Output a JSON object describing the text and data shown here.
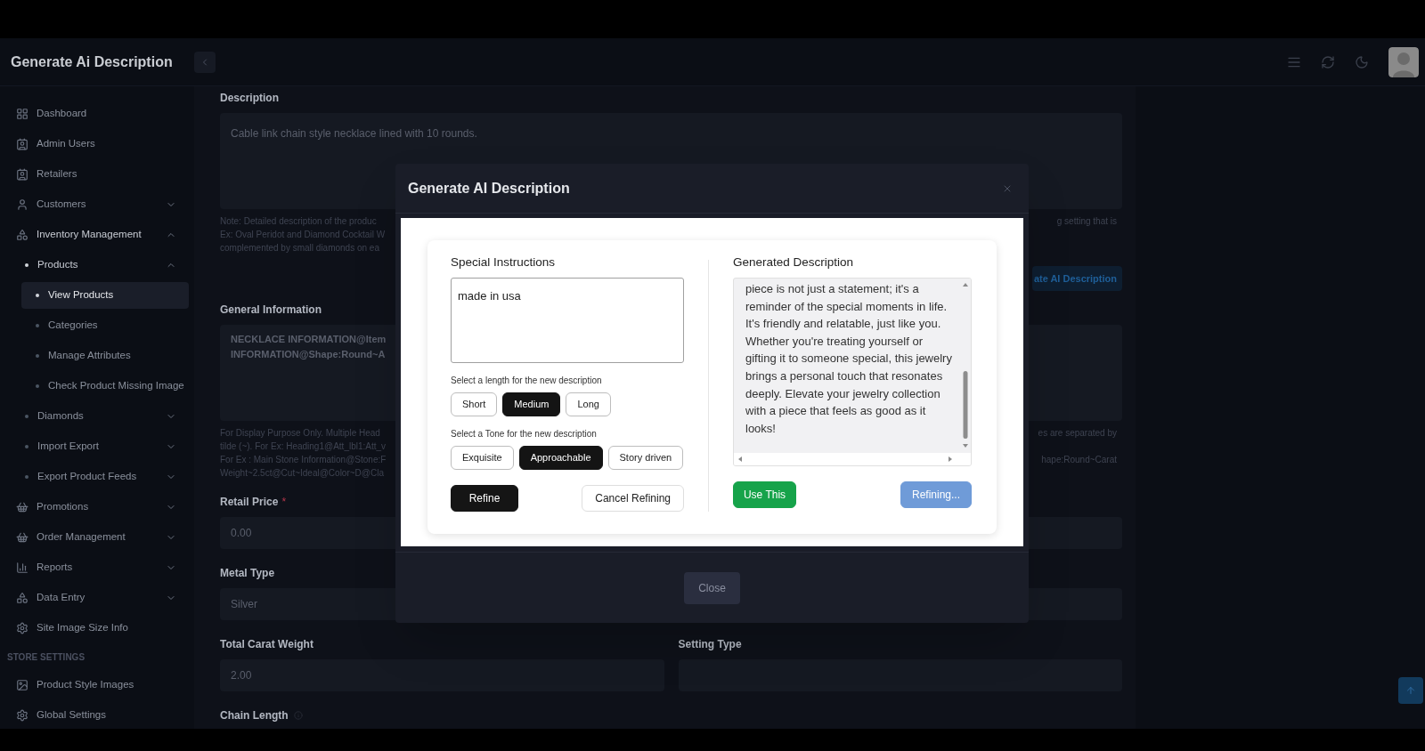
{
  "header": {
    "title": "Generate Ai Description"
  },
  "sidebar": {
    "groups": [
      {
        "items": [
          {
            "label": "Dashboard",
            "selected": false
          },
          {
            "label": "Admin Users",
            "selected": false
          },
          {
            "label": "Retailers",
            "selected": false
          },
          {
            "label": "Customers",
            "selected": false,
            "expanded": false
          },
          {
            "label": "Inventory Management",
            "selected": false,
            "expanded": true,
            "children": [
              {
                "label": "Products",
                "selected": false,
                "expanded": true,
                "children": [
                  {
                    "label": "View Products",
                    "selected": true
                  },
                  {
                    "label": "Categories",
                    "selected": false
                  },
                  {
                    "label": "Manage Attributes",
                    "selected": false
                  },
                  {
                    "label": "Check Product Missing Image",
                    "selected": false
                  }
                ]
              },
              {
                "label": "Diamonds",
                "selected": false,
                "expanded": false
              },
              {
                "label": "Import Export",
                "selected": false,
                "expanded": false
              },
              {
                "label": "Export Product Feeds",
                "selected": false,
                "expanded": false
              }
            ]
          },
          {
            "label": "Promotions",
            "selected": false,
            "expanded": false
          },
          {
            "label": "Order Management",
            "selected": false,
            "expanded": false
          },
          {
            "label": "Reports",
            "selected": false,
            "expanded": false
          },
          {
            "label": "Data Entry",
            "selected": false,
            "expanded": false
          },
          {
            "label": "Site Image Size Info",
            "selected": false
          }
        ]
      },
      {
        "heading": "STORE SETTINGS",
        "items": [
          {
            "label": "Product Style Images",
            "selected": false
          },
          {
            "label": "Global Settings",
            "selected": false
          }
        ]
      }
    ]
  },
  "form": {
    "description": {
      "label": "Description",
      "value": "Cable link chain style necklace lined with 10 rounds.",
      "notes": [
        {
          "left": "Note: Detailed description of the produc",
          "right": "g setting that is"
        },
        {
          "left": "Ex: Oval Peridot and Diamond Cocktail W"
        },
        {
          "left": "complemented by small diamonds on ea"
        }
      ],
      "ai_button": "ate AI Description"
    },
    "general": {
      "label": "General Information",
      "value_lines": [
        "NECKLACE INFORMATION@Item",
        "INFORMATION@Shape:Round~A"
      ],
      "notes": [
        {
          "left": "For Display Purpose Only. Multiple Head",
          "right": "es are separated by"
        },
        {
          "left": "tilde (~). For Ex: Heading1@Att_lbl1:Att_v"
        },
        {
          "left": "For Ex : Main Stone Information@Stone:F",
          "right": "hape:Round~Carat"
        },
        {
          "left": "Weight~2.5ct@Cut~Ideal@Color~D@Cla"
        }
      ]
    },
    "retail_price": {
      "label": "Retail Price",
      "required_mark": "*",
      "value": "0.00"
    },
    "metal_type": {
      "label": "Metal Type",
      "value": "Silver"
    },
    "total_carat_weight": {
      "label": "Total Carat Weight",
      "value": "2.00"
    },
    "setting_type": {
      "label": "Setting Type"
    },
    "chain_length": {
      "label": "Chain Length"
    }
  },
  "modal": {
    "title": "Generate AI Description",
    "instructions": {
      "label": "Special Instructions",
      "value": "made in usa"
    },
    "length": {
      "label": "Select a length for the new description",
      "options": [
        {
          "label": "Short",
          "selected": false
        },
        {
          "label": "Medium",
          "selected": true
        },
        {
          "label": "Long",
          "selected": false
        }
      ]
    },
    "tone": {
      "label": "Select a Tone for the new description",
      "options": [
        {
          "label": "Exquisite",
          "selected": false
        },
        {
          "label": "Approachable",
          "selected": true
        },
        {
          "label": "Story driven",
          "selected": false
        }
      ]
    },
    "actions": [
      {
        "label": "Refine",
        "kind": "primary"
      },
      {
        "label": "Cancel Refining",
        "kind": "outline"
      }
    ],
    "generated": {
      "label": "Generated Description",
      "text": "piece is not just a statement; it's a reminder of the special moments in life. It's friendly and relatable, just like you. Whether you're treating yourself or gifting it to someone special, this jewelry brings a personal touch that resonates deeply. Elevate your jewelry collection with a piece that feels as good as it looks!"
    },
    "result_actions": [
      {
        "label": "Use This",
        "kind": "success"
      },
      {
        "label": "Refining...",
        "kind": "busy"
      }
    ],
    "footer_button": "Close"
  }
}
